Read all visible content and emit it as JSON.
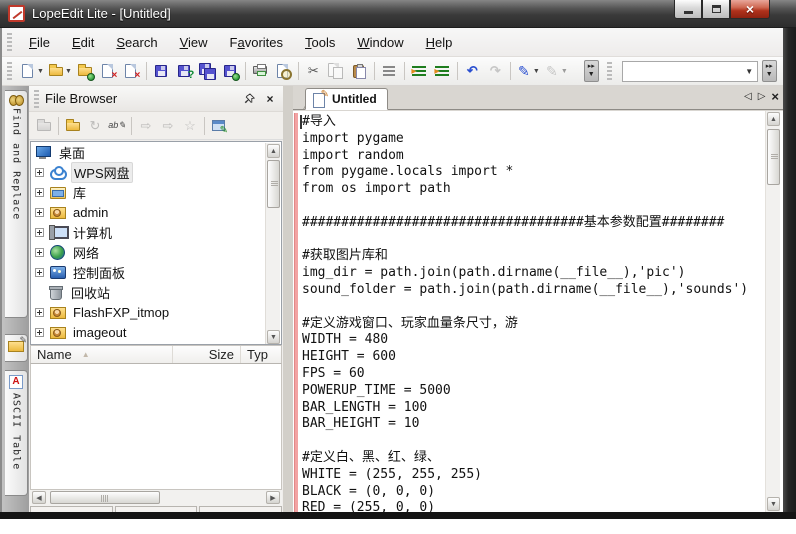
{
  "window": {
    "title": "LopeEdit Lite - [Untitled]"
  },
  "menu": {
    "items": [
      {
        "label": "File",
        "mnemonic": "F"
      },
      {
        "label": "Edit",
        "mnemonic": "E"
      },
      {
        "label": "Search",
        "mnemonic": "S"
      },
      {
        "label": "View",
        "mnemonic": "V"
      },
      {
        "label": "Favorites",
        "mnemonic": "a"
      },
      {
        "label": "Tools",
        "mnemonic": "T"
      },
      {
        "label": "Window",
        "mnemonic": "W"
      },
      {
        "label": "Help",
        "mnemonic": "H"
      }
    ]
  },
  "toolbar": {
    "combobox_value": "",
    "icons": [
      "new-document",
      "open-file",
      "open-from-web",
      "close-document",
      "close-all-documents",
      "save",
      "save-as",
      "save-all",
      "save-remote",
      "print",
      "print-preview",
      "cut",
      "copy",
      "paste",
      "format-lines",
      "indent",
      "outdent",
      "undo",
      "redo",
      "highlight-pen",
      "stamp-pen",
      "toolbar-overflow",
      "toolbar-overflow"
    ]
  },
  "dock": {
    "tabs": [
      {
        "label": "Find and Replace",
        "icon": "binoculars-icon"
      },
      {
        "label": "",
        "icon": "file-browser-folder-icon"
      },
      {
        "label": "ASCII Table",
        "icon": "ascii-a-icon"
      }
    ],
    "ascii_glyph": "A"
  },
  "file_browser": {
    "title": "File Browser",
    "toolbar_icons": [
      "open-disabled",
      "browse-folder",
      "refresh",
      "rename",
      "open-with",
      "send-to",
      "favorite",
      "properties"
    ],
    "tool_glyphs": {
      "refresh": "↻",
      "rename": "ab✎",
      "arrow": "⇨",
      "star": "☆"
    },
    "tree": [
      {
        "label": "桌面",
        "icon": "desktop"
      },
      {
        "label": "WPS网盘",
        "icon": "cloud",
        "selected": true
      },
      {
        "label": "库",
        "icon": "libraries"
      },
      {
        "label": "admin",
        "icon": "user-folder"
      },
      {
        "label": "计算机",
        "icon": "computer"
      },
      {
        "label": "网络",
        "icon": "network"
      },
      {
        "label": "控制面板",
        "icon": "control-panel"
      },
      {
        "label": "回收站",
        "icon": "recycle-bin"
      },
      {
        "label": "FlashFXP_itmop",
        "icon": "folder"
      },
      {
        "label": "imageout",
        "icon": "folder"
      }
    ],
    "columns": {
      "name": "Name",
      "size": "Size",
      "type": "Typ"
    }
  },
  "editor": {
    "tab_label": "Untitled",
    "nav": {
      "prev": "◁",
      "next": "▷",
      "close": "×"
    },
    "lines": [
      "#导入",
      "import pygame",
      "import random",
      "from pygame.locals import *",
      "from os import path",
      "",
      "####################################基本参数配置########",
      "",
      "#获取图片库和",
      "img_dir = path.join(path.dirname(__file__),'pic')",
      "sound_folder = path.join(path.dirname(__file__),'sounds')",
      "",
      "#定义游戏窗口、玩家血量条尺寸，游",
      "WIDTH = 480",
      "HEIGHT = 600",
      "FPS = 60",
      "POWERUP_TIME = 5000",
      "BAR_LENGTH = 100",
      "BAR_HEIGHT = 10",
      "",
      "#定义白、黑、红、绿、",
      "WHITE = (255, 255, 255)",
      "BLACK = (0, 0, 0)",
      "RED = (255, 0, 0)"
    ]
  },
  "colors": {
    "titlebar": "#3a3a3a",
    "close_button": "#b0321c",
    "change_bar": "#f2a3a3",
    "folder_yellow": "#ecb93e",
    "editor_background": "#ffffff"
  }
}
